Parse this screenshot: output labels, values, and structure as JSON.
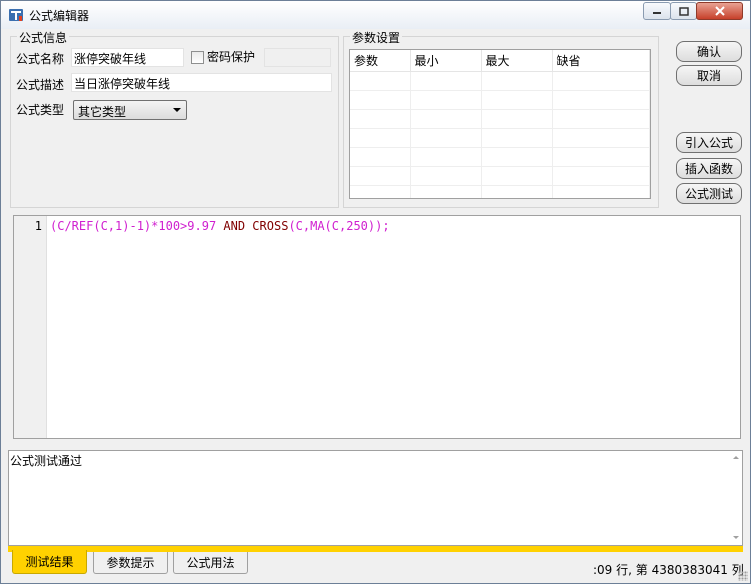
{
  "window": {
    "title": "公式编辑器",
    "icons": {
      "app": "formula-app-icon",
      "minimize": "minimize-icon",
      "maximize": "maximize-icon",
      "close": "close-icon"
    }
  },
  "formula_info": {
    "group_title": "公式信息",
    "name_label": "公式名称",
    "name_value": "涨停突破年线",
    "password_label": "密码保护",
    "password_checked": false,
    "password_value": "",
    "desc_label": "公式描述",
    "desc_value": "当日涨停突破年线",
    "type_label": "公式类型",
    "type_value": "其它类型"
  },
  "params": {
    "group_title": "参数设置",
    "columns": [
      "参数",
      "最小",
      "最大",
      "缺省"
    ],
    "rows": [
      [
        "",
        "",
        "",
        ""
      ],
      [
        "",
        "",
        "",
        ""
      ],
      [
        "",
        "",
        "",
        ""
      ],
      [
        "",
        "",
        "",
        ""
      ],
      [
        "",
        "",
        "",
        ""
      ],
      [
        "",
        "",
        "",
        ""
      ],
      [
        "",
        "",
        "",
        ""
      ]
    ]
  },
  "buttons": {
    "confirm": "确认",
    "cancel": "取消",
    "import": "引入公式",
    "insert_func": "插入函数",
    "test": "公式测试"
  },
  "editor": {
    "line_number": "1",
    "code_parts": [
      "(C/REF(C,1)-1)*100>9.97 ",
      "AND",
      " CROSS",
      "(C,MA(C,250));"
    ]
  },
  "output": {
    "text": "公式测试通过"
  },
  "tabs": {
    "items": [
      "测试结果",
      "参数提示",
      "公式用法"
    ],
    "active": 0
  },
  "status": {
    "text": ":09 行, 第 4380383041 列"
  },
  "colors": {
    "code_pink": "#d020d0",
    "keyword": "#800000",
    "tab_active": "#ffd100"
  }
}
